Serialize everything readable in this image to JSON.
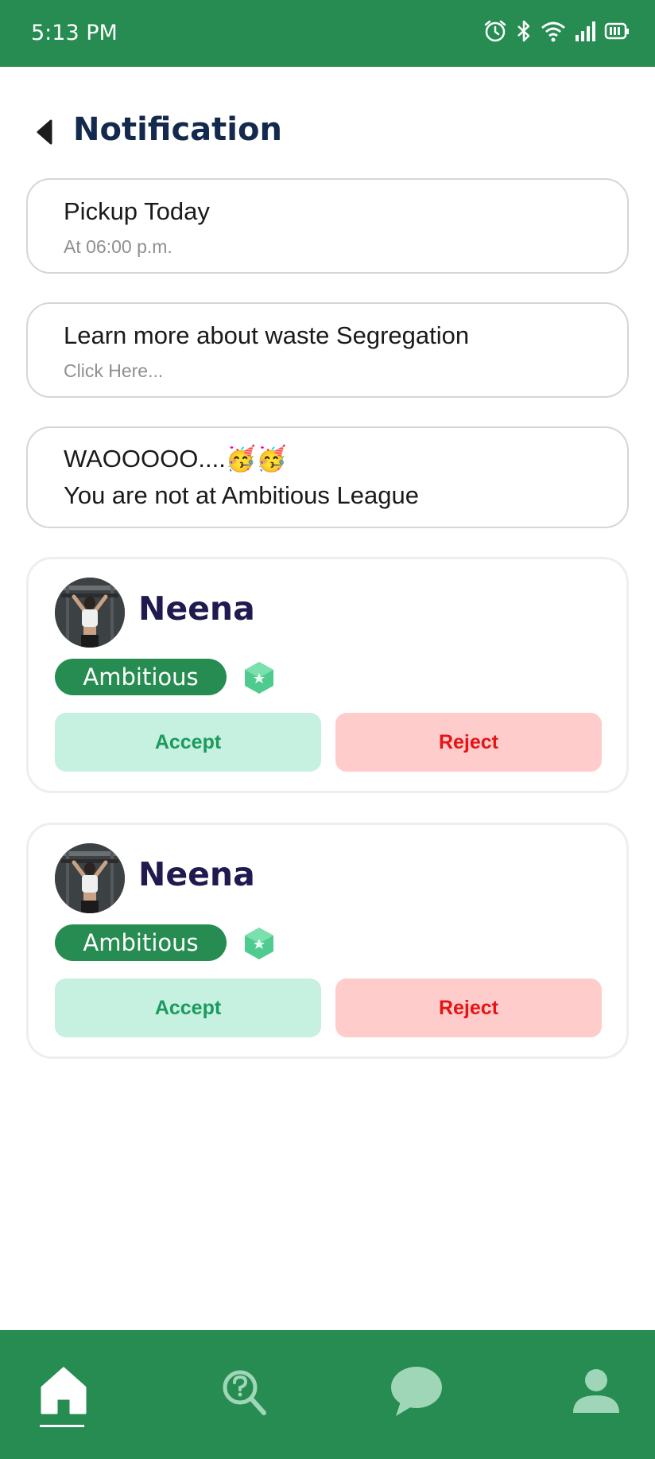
{
  "status_bar": {
    "time": "5:13 PM",
    "icons": [
      "alarm-icon",
      "bluetooth-icon",
      "wifi-icon",
      "signal-icon",
      "battery-icon"
    ]
  },
  "header": {
    "title": "Notification",
    "back_icon": "back-arrow-icon"
  },
  "notifications": [
    {
      "title": "Pickup Today",
      "subtitle": "At 06:00 p.m."
    },
    {
      "title": "Learn more about waste Segregation",
      "subtitle": "Click Here..."
    },
    {
      "line1": "WAOOOOO....🥳🥳",
      "line2": "You are not at Ambitious League"
    }
  ],
  "requests": [
    {
      "name": "Neena",
      "league": "Ambitious",
      "accept_label": "Accept",
      "reject_label": "Reject"
    },
    {
      "name": "Neena",
      "league": "Ambitious",
      "accept_label": "Accept",
      "reject_label": "Reject"
    }
  ],
  "bottom_nav": {
    "items": [
      "home-icon",
      "search-help-icon",
      "chat-icon",
      "profile-icon"
    ],
    "active": "home-icon"
  },
  "colors": {
    "brand_green": "#268c51",
    "title_navy": "#13294d",
    "accept_bg": "#c6f0df",
    "accept_text": "#1b9a5e",
    "reject_bg": "#ffcccc",
    "reject_text": "#e61414"
  }
}
